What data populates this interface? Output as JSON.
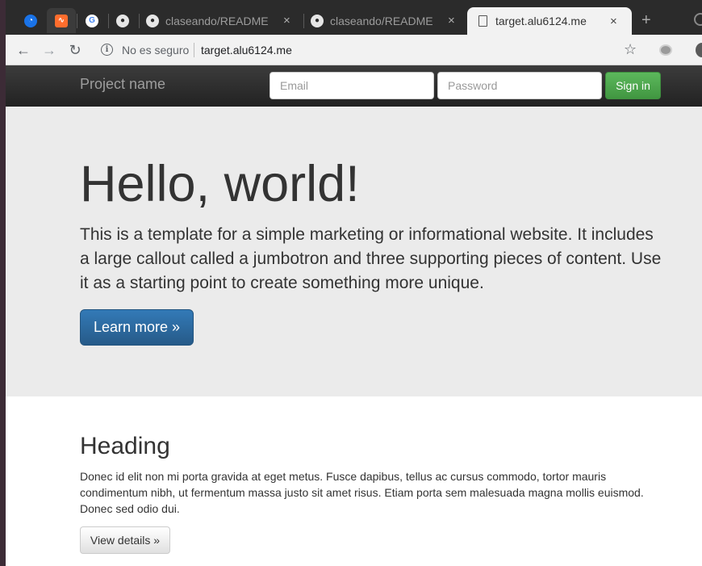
{
  "browser": {
    "tabs": [
      {
        "title": "claseando/README"
      },
      {
        "title": "claseando/README"
      },
      {
        "title": "target.alu6124.me",
        "active": true
      }
    ],
    "close_glyph": "×",
    "new_tab_glyph": "+",
    "security_label": "No es seguro",
    "url": "target.alu6124.me",
    "icons": {
      "back": "←",
      "forward": "→",
      "reload": "↻",
      "info": "i",
      "star": "☆"
    }
  },
  "navbar": {
    "brand": "Project name",
    "email_placeholder": "Email",
    "password_placeholder": "Password",
    "signin_label": "Sign in"
  },
  "jumbotron": {
    "title": "Hello, world!",
    "text": "This is a template for a simple marketing or informational website. It includes a large callout called a jumbotron and three supporting pieces of content. Use it as a starting point to create something more unique.",
    "button_label": "Learn more »"
  },
  "section": {
    "heading": "Heading",
    "body": "Donec id elit non mi porta gravida at eget metus. Fusce dapibus, tellus ac cursus commodo, tortor mauris condimentum nibh, ut fermentum massa justo sit amet risus. Etiam porta sem malesuada magna mollis euismod. Donec sed odio dui.",
    "button_label": "View details »"
  },
  "colors": {
    "primary": "#337ab7",
    "success": "#5cb85c",
    "navbar": "#222222",
    "jumbotron": "#ebebeb"
  }
}
